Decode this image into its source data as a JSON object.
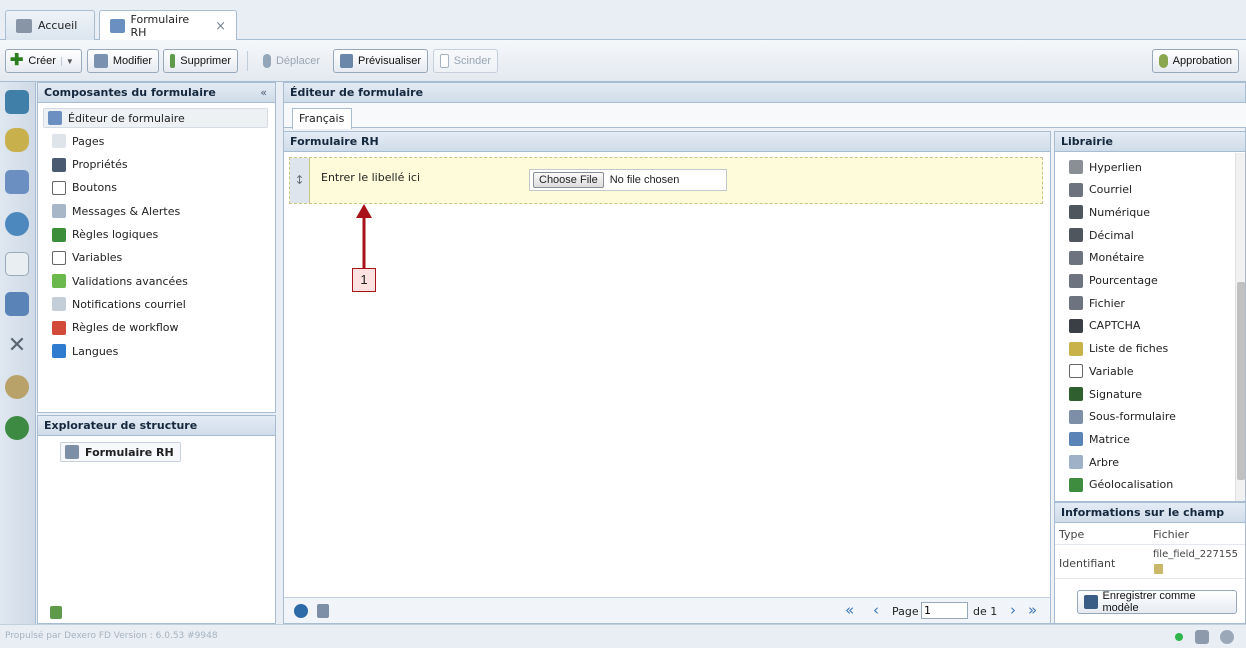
{
  "tabs": [
    {
      "label": "Accueil"
    },
    {
      "label": "Formulaire RH",
      "close": "×"
    }
  ],
  "toolbar": {
    "create": "Créer",
    "modify": "Modifier",
    "delete": "Supprimer",
    "move": "Déplacer",
    "preview": "Prévisualiser",
    "split": "Scinder",
    "approval": "Approbation"
  },
  "components_panel": {
    "title": "Composantes du formulaire",
    "collapse_glyph": "«",
    "items": [
      {
        "label": "Éditeur de formulaire",
        "icon": "form-editor-icon",
        "color": "#6b8fc1"
      },
      {
        "label": "Pages",
        "icon": "page-icon",
        "color": "#dfe4ea"
      },
      {
        "label": "Propriétés",
        "icon": "properties-icon",
        "color": "#4a5a70"
      },
      {
        "label": "Boutons",
        "icon": "buttons-icon",
        "color": "#ffffff"
      },
      {
        "label": "Messages & Alertes",
        "icon": "message-icon",
        "color": "#a8b7c8"
      },
      {
        "label": "Règles logiques",
        "icon": "logic-rules-icon",
        "color": "#3c8f3a"
      },
      {
        "label": "Variables",
        "icon": "sqrt-x-icon",
        "color": "#ffffff"
      },
      {
        "label": "Validations avancées",
        "icon": "validation-icon",
        "color": "#6bb84c"
      },
      {
        "label": "Notifications courriel",
        "icon": "envelope-icon",
        "color": "#c4ced9"
      },
      {
        "label": "Règles de workflow",
        "icon": "workflow-icon",
        "color": "#d24a3a"
      },
      {
        "label": "Langues",
        "icon": "language-flag-icon",
        "color": "#2e7bcf"
      }
    ]
  },
  "structure_panel": {
    "title": "Explorateur de structure",
    "root": "Formulaire RH"
  },
  "editor": {
    "title": "Éditeur de formulaire",
    "language_tab": "Français",
    "form_title": "Formulaire RH",
    "field_label": "Entrer le libellé ici",
    "file_button": "Choose File",
    "file_status": "No file chosen",
    "drag_glyph": "↕",
    "callout_number": "1",
    "pager": {
      "page_label": "Page",
      "page_value": "1",
      "of_label": "de 1"
    }
  },
  "library": {
    "title": "Librairie",
    "items": [
      {
        "label": "Hyperlien",
        "icon": "hyperlink-icon",
        "color": "#8a8f96"
      },
      {
        "label": "Courriel",
        "icon": "at-sign-icon",
        "color": "#6d7480"
      },
      {
        "label": "Numérique",
        "icon": "numeric-icon",
        "color": "#50565e"
      },
      {
        "label": "Décimal",
        "icon": "decimal-icon",
        "color": "#50565e"
      },
      {
        "label": "Monétaire",
        "icon": "currency-icon",
        "color": "#6d7480"
      },
      {
        "label": "Pourcentage",
        "icon": "percent-icon",
        "color": "#6d7480"
      },
      {
        "label": "Fichier",
        "icon": "paperclip-icon",
        "color": "#6d7480"
      },
      {
        "label": "CAPTCHA",
        "icon": "captcha-icon",
        "color": "#3a3f46"
      },
      {
        "label": "Liste de fiches",
        "icon": "record-list-icon",
        "color": "#c9b24a"
      },
      {
        "label": "Variable",
        "icon": "sqrt-x-icon",
        "color": "#ffffff"
      },
      {
        "label": "Signature",
        "icon": "signature-icon",
        "color": "#2f5f2f"
      },
      {
        "label": "Sous-formulaire",
        "icon": "subform-icon",
        "color": "#7d8fa6"
      },
      {
        "label": "Matrice",
        "icon": "matrix-icon",
        "color": "#5a84b8"
      },
      {
        "label": "Arbre",
        "icon": "tree-icon",
        "color": "#9fb1c6"
      },
      {
        "label": "Géolocalisation",
        "icon": "globe-icon",
        "color": "#3e8c3e"
      }
    ]
  },
  "field_info": {
    "title": "Informations sur le champ",
    "rows": [
      {
        "key": "Type",
        "value": "Fichier"
      },
      {
        "key": "Identifiant",
        "value": "file_field_227155"
      }
    ],
    "save_template": "Enregistrer comme modèle"
  },
  "footer": {
    "powered_by": "Propulsé par Dexero FD Version : 6.0.53 #9948"
  },
  "colors": {
    "accent_arrow": "#a8131b",
    "callout_bg": "#fde2e2",
    "field_bg": "#fdfbd9",
    "status_green": "#2fb54a"
  }
}
